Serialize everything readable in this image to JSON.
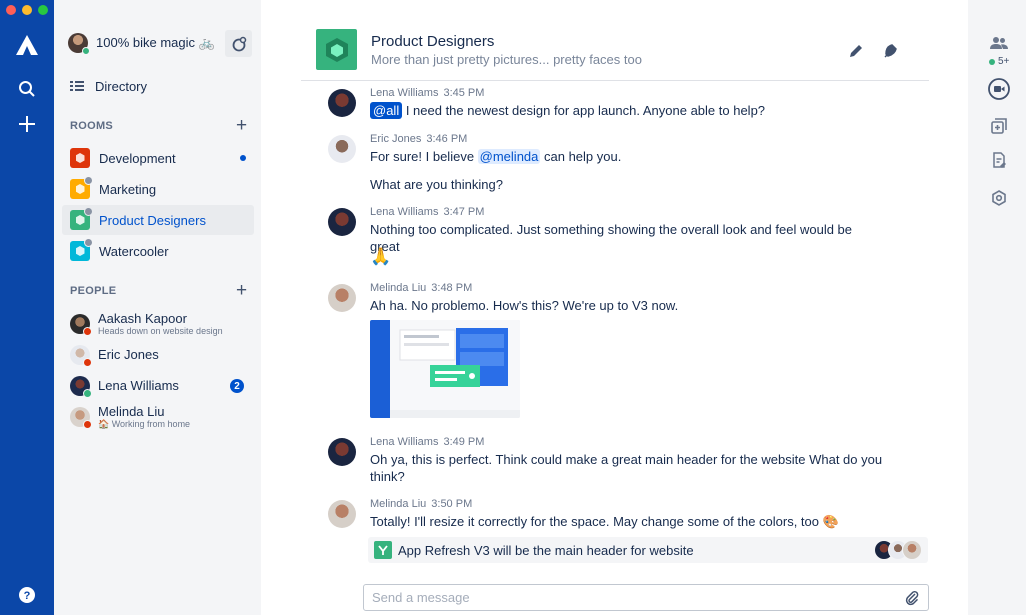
{
  "window": {
    "controls": [
      "close",
      "minimize",
      "zoom"
    ]
  },
  "global_nav": {
    "logo": "atlassian-logo",
    "icons": [
      "search-icon",
      "plus-icon",
      "help-icon"
    ]
  },
  "sidebar": {
    "user_status": "100% bike magic 🚲",
    "directory_label": "Directory",
    "rooms_heading": "ROOMS",
    "rooms": [
      {
        "label": "Development",
        "color": "#de350b",
        "unread": true
      },
      {
        "label": "Marketing",
        "color": "#ffab00",
        "unread": false
      },
      {
        "label": "Product Designers",
        "color": "#36b37e",
        "active": true
      },
      {
        "label": "Watercooler",
        "color": "#00b8d9",
        "unread": false
      }
    ],
    "people_heading": "PEOPLE",
    "people": [
      {
        "name": "Aakash Kapoor",
        "status": "Heads down on website design",
        "presence_color": "#de350b"
      },
      {
        "name": "Eric Jones",
        "status": "",
        "presence_color": "#de350b"
      },
      {
        "name": "Lena Williams",
        "status": "",
        "presence_color": "#36b37e",
        "badge": "2"
      },
      {
        "name": "Melinda Liu",
        "status": "🏠 Working from home",
        "presence_color": "#de350b"
      }
    ]
  },
  "header": {
    "title": "Product Designers",
    "topic": "More than just pretty pictures... pretty faces too"
  },
  "messages": [
    {
      "author": "Lena Williams",
      "time": "3:45 PM",
      "mention": "@all",
      "text": " I need the newest design for app launch. Anyone able to help?"
    },
    {
      "author": "Eric Jones",
      "time": "3:46 PM",
      "text_before": "For sure! I believe ",
      "mention": "@melinda",
      "text_after": " can help you.",
      "text2": "What are you thinking?"
    },
    {
      "author": "Lena Williams",
      "time": "3:47 PM",
      "text": "Nothing too complicated. Just something showing the overall look and feel would be great",
      "emoji": "🙏"
    },
    {
      "author": "Melinda Liu",
      "time": "3:48 PM",
      "text": "Ah ha. No problemo. How's this? We're up to V3 now."
    },
    {
      "author": "Lena Williams",
      "time": "3:49 PM",
      "text": "Oh ya, this is perfect. Think could make a great main header for the website What do you think?"
    },
    {
      "author": "Melinda Liu",
      "time": "3:50 PM",
      "text": "Totally! I'll resize it correctly for the space. May change some of the colors, too",
      "emoji": "🎨"
    }
  ],
  "card": {
    "text": "App Refresh V3 will be the main header for website"
  },
  "composer": {
    "placeholder": "Send a message"
  },
  "rail": {
    "participants_count": "5+"
  },
  "colors": {
    "nav": "#0b47a8",
    "accent": "#0052cc",
    "room_green": "#36b37e"
  }
}
